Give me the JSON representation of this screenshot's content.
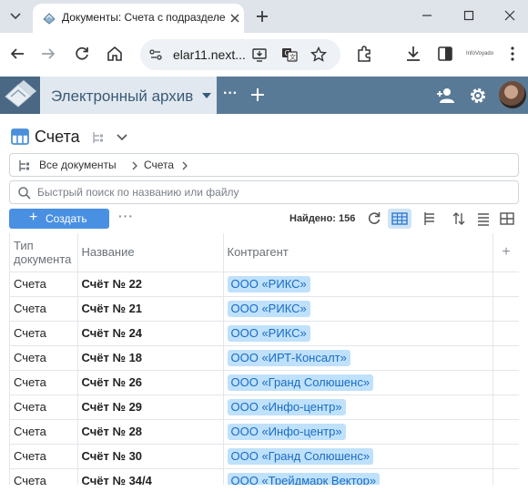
{
  "browser": {
    "tab_title": "Документы: Счета с подразделениями",
    "url": "elar11.next...",
    "profile_label": "InfoVoyado"
  },
  "app": {
    "title": "Электронный архив"
  },
  "page": {
    "title": "Счета",
    "breadcrumb": [
      "Все документы",
      "Счета"
    ],
    "search_placeholder": "Быстрый поиск по названию или файлу",
    "create_label": "Создать",
    "found_label": "Найдено:",
    "found_count": "156"
  },
  "table": {
    "columns": [
      "Тип документа",
      "Название",
      "Контрагент"
    ],
    "rows": [
      {
        "type": "Счета",
        "name": "Счёт № 22",
        "counterparty": "ООО «РИКС»"
      },
      {
        "type": "Счета",
        "name": "Счёт № 21",
        "counterparty": "ООО «РИКС»"
      },
      {
        "type": "Счета",
        "name": "Счёт № 24",
        "counterparty": "ООО «РИКС»"
      },
      {
        "type": "Счета",
        "name": "Счёт № 18",
        "counterparty": "ООО «ИРТ-Консалт»"
      },
      {
        "type": "Счета",
        "name": "Счёт № 26",
        "counterparty": "ООО «Гранд Солюшенс»"
      },
      {
        "type": "Счета",
        "name": "Счёт № 29",
        "counterparty": "ООО «Инфо-центр»"
      },
      {
        "type": "Счета",
        "name": "Счёт № 28",
        "counterparty": "ООО «Инфо-центр»"
      },
      {
        "type": "Счета",
        "name": "Счёт № 30",
        "counterparty": "ООО «Гранд Солюшенс»"
      },
      {
        "type": "Счета",
        "name": "Счёт № 34/4",
        "counterparty": "ООО «Трейдмарк Вектор»"
      }
    ]
  },
  "colors": {
    "appbar": "#597a96",
    "accent": "#4a90e2",
    "chip_bg": "#bfe1fb",
    "chip_text": "#1a6cc4"
  }
}
